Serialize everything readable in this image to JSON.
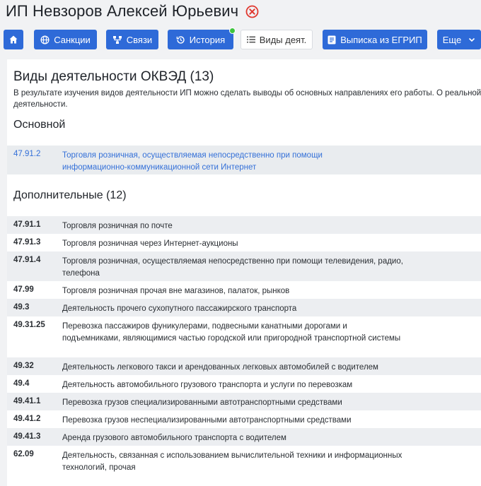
{
  "header": {
    "name": "ИП Невзоров Алексей Юрьевич"
  },
  "toolbar": {
    "sanctions": "Санкции",
    "links": "Связи",
    "history": "История",
    "activities": "Виды деят.",
    "extract": "Выписка из ЕГРИП",
    "more": "Еще"
  },
  "section": {
    "title": "Виды деятельности ОКВЭД (13)",
    "description": "В результате изучения видов деятельности ИП можно сделать выводы об основных направлениях его работы. О реальной деятельности."
  },
  "main": {
    "heading": "Основной",
    "code": "47.91.2",
    "text": "Торговля розничная, осуществляемая непосредственно при помощи информационно-коммуникационной сети Интернет"
  },
  "additional": {
    "heading": "Дополнительные (12)",
    "rows": [
      {
        "code": "47.91.1",
        "text": "Торговля розничная по почте"
      },
      {
        "code": "47.91.3",
        "text": "Торговля розничная через Интернет-аукционы"
      },
      {
        "code": "47.91.4",
        "text": "Торговля розничная, осуществляемая непосредственно при помощи телевидения, радио, телефона"
      },
      {
        "code": "47.99",
        "text": "Торговля розничная прочая вне магазинов, палаток, рынков"
      },
      {
        "code": "49.3",
        "text": "Деятельность прочего сухопутного пассажирского транспорта"
      },
      {
        "code": "49.31.25",
        "text": "Перевозка пассажиров фуникулерами, подвесными канатными дорогами и подъемниками, являющимися частью городской или пригородной транспортной системы"
      },
      {
        "code": "49.32",
        "text": "Деятельность легкового такси и арендованных легковых автомобилей с водителем"
      },
      {
        "code": "49.4",
        "text": "Деятельность автомобильного грузового транспорта и услуги по перевозкам"
      },
      {
        "code": "49.41.1",
        "text": "Перевозка грузов специализированными автотранспортными средствами"
      },
      {
        "code": "49.41.2",
        "text": "Перевозка грузов неспециализированными автотранспортными средствами"
      },
      {
        "code": "49.41.3",
        "text": "Аренда грузового автомобильного транспорта с водителем"
      },
      {
        "code": "62.09",
        "text": "Деятельность, связанная с использованием вычислительной техники и информационных технологий, прочая"
      }
    ]
  }
}
